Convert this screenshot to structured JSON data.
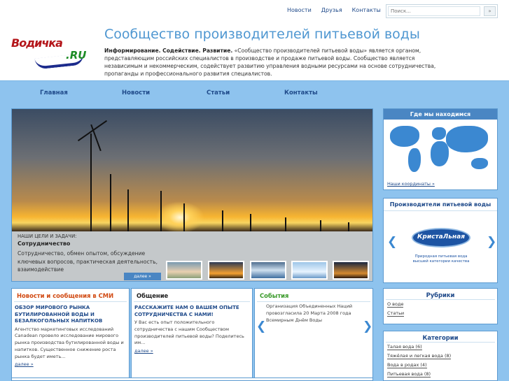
{
  "topnav": [
    "Новости",
    "Друзья",
    "Контакты"
  ],
  "search": {
    "placeholder": "Поиск...",
    "button": "»"
  },
  "logo": {
    "word1": "Водичка",
    "word2": ".RU"
  },
  "site_title": "Сообщество производителей питьевой воды",
  "intro": {
    "bold": "Информирование. Содействие. Развитие.",
    "text": " «Сообщество производителей питьевой воды» является органом, представляющим российских специалистов в производстве и продаже питьевой воды. Сообщество является независимым и некоммерческим, содействует развитию управления водными ресурсами на основе сотрудничества, пропаганды и профессионального развития специалистов."
  },
  "mainnav": [
    "Главная",
    "Новости",
    "Статьи",
    "Контакты"
  ],
  "slider": {
    "kicker": "НАШИ ЦЕЛИ И ЗАДАЧИ:",
    "heading": "Сотрудничество",
    "text": "Сотрудничество, обмен опытом, обсуждение ключевых вопросов, практическая деятельность, взаимодействие",
    "more": "далее »"
  },
  "location": {
    "title": "Где мы находимся",
    "link": "Наши координаты »"
  },
  "producers": {
    "title": "Производители питьевой воды",
    "logo_text": "КристаЛьная",
    "logo_sub": "Природная питьевая вода высшей категории качества",
    "prev": "❮",
    "next": "❯"
  },
  "news": {
    "title": "Новости и сообщения в СМИ",
    "item_title": "ОБЗОР МИРОВОГО РЫНКА БУТИЛИРОВАННОЙ ВОДЫ И БЕЗАЛКОГОЛЬНЫХ НАПИТКОВ",
    "item_text": "Агентство маркетинговых исследований Canadean провело исследование мирового рынка производства бутилированной воды и напитков. Существенное снижение роста рынка будет иметь...",
    "more": "далее »"
  },
  "talk": {
    "title": "Общение",
    "item_title": "РАССКАЖИТЕ НАМ О ВАШЕМ ОПЫТЕ СОТРУДНИЧЕСТВА С НАМИ!",
    "item_text": "У Вас есть опыт положительного сотрудничества с нашим Сообществом производителей питьевой воды? Поделитесь им...",
    "more": "далее »"
  },
  "events": {
    "title": "События",
    "item_text": "Организация Объединенных Наций провозгласила 20 Марта 2008 года Всемирным Днём Воды",
    "prev": "❮",
    "next": "❯"
  },
  "rubrics": {
    "title": "Рубрики",
    "items": [
      "О воде",
      "Статьи"
    ]
  },
  "categories": {
    "title": "Категории",
    "items": [
      "Талая вода (6)",
      "Тяжёлая и легкая вода (8)",
      "Вода в родах (4)",
      "Питьевая вода (8)"
    ]
  },
  "colors": {
    "accent": "#4a86c3",
    "band": "#8ec3ee",
    "news_title": "#d14a12",
    "events_title": "#3a9a2a"
  }
}
